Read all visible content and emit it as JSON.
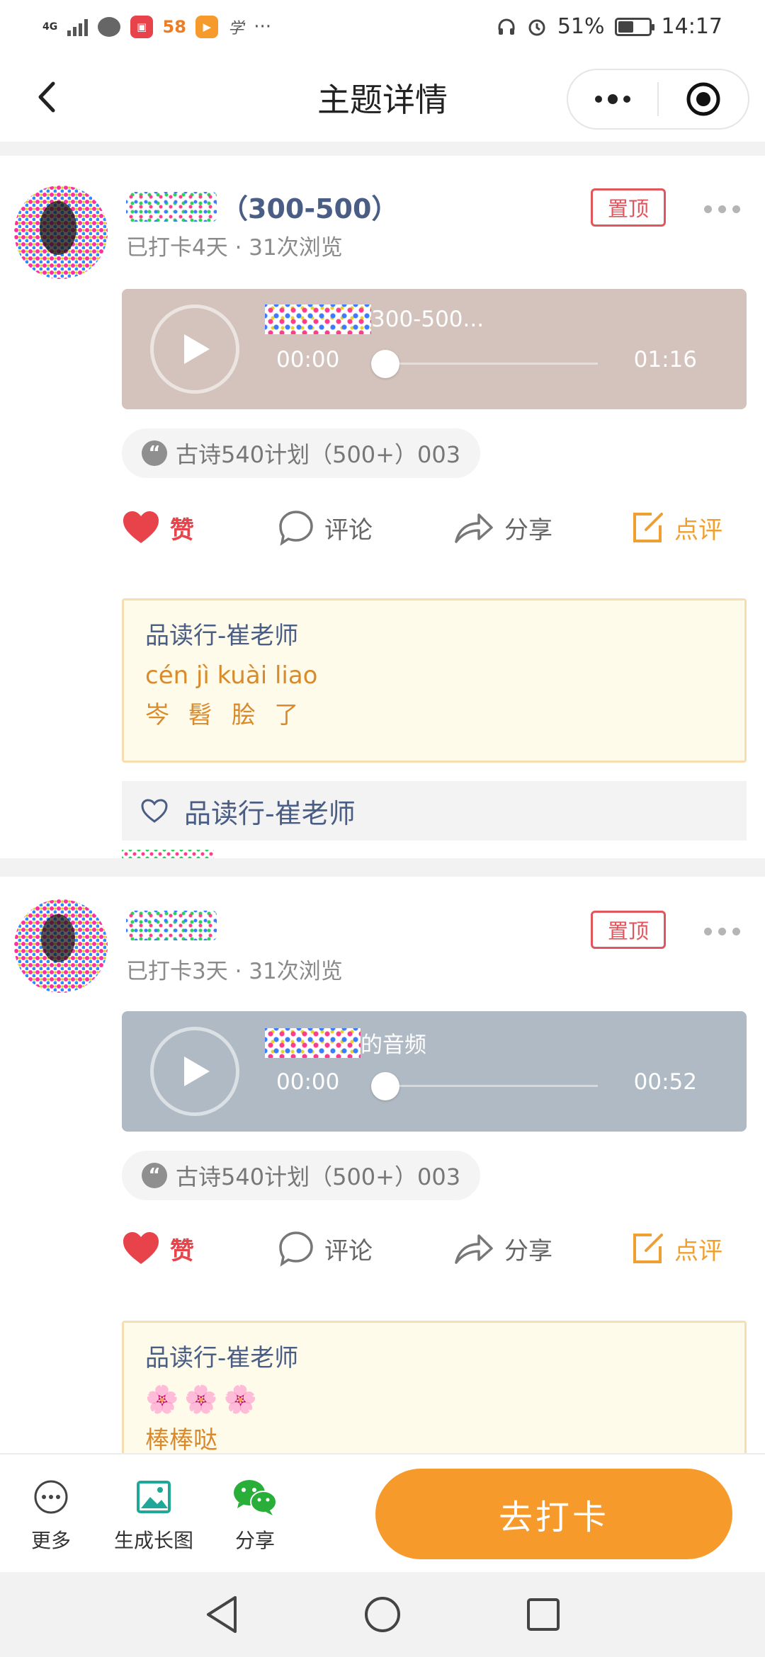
{
  "status_bar": {
    "network": "4G",
    "app_58": "58",
    "app_text": "学",
    "more": "···",
    "battery": "51%",
    "time": "14:17"
  },
  "nav": {
    "title": "主题详情"
  },
  "posts": [
    {
      "name_suffix": "（300-500）",
      "meta": "已打卡4天 · 31次浏览",
      "pin_label": "置顶",
      "audio": {
        "title_suffix": "300-500...",
        "time_start": "00:00",
        "time_end": "01:16",
        "color": "#d3c3bc"
      },
      "tag": "古诗540计划（500+）003",
      "actions": {
        "like": "赞",
        "comment": "评论",
        "share": "分享",
        "review": "点评"
      },
      "review": {
        "reviewer": "品读行-崔老师",
        "line1": "cén jì kuài liao",
        "line2": "岑 髫 脍 了"
      },
      "liked_by": "品读行-崔老师"
    },
    {
      "name_suffix": "",
      "meta": "已打卡3天 · 31次浏览",
      "pin_label": "置顶",
      "audio": {
        "title_suffix": "的音频",
        "time_start": "00:00",
        "time_end": "00:52",
        "color": "#b0bac4"
      },
      "tag": "古诗540计划（500+）003",
      "actions": {
        "like": "赞",
        "comment": "评论",
        "share": "分享",
        "review": "点评"
      },
      "review": {
        "reviewer": "品读行-崔老师",
        "flowers": "🌸🌸🌸",
        "line2": "棒棒哒"
      }
    }
  ],
  "toolbar": {
    "more": "更多",
    "long_image": "生成长图",
    "share": "分享",
    "checkin": "去打卡"
  },
  "colors": {
    "accent": "#f79a2c",
    "like_red": "#e8424b",
    "review_orange": "#f0a030",
    "pin_red": "#e1565c",
    "name_blue": "#4a5d85"
  }
}
